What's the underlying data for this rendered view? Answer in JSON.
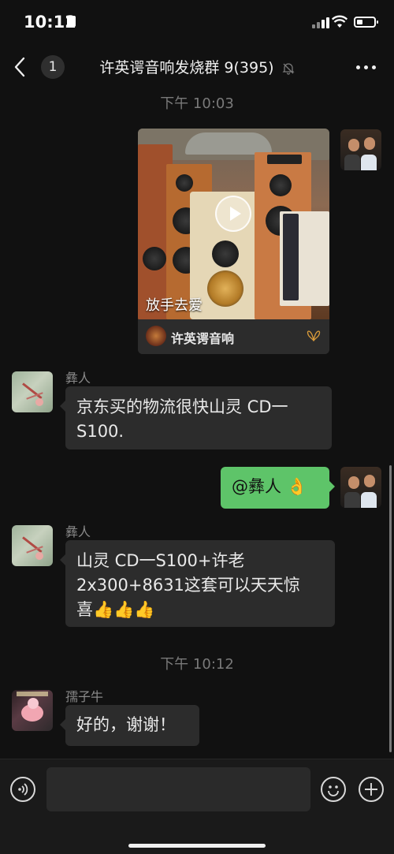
{
  "status_bar": {
    "time": "10:12"
  },
  "nav": {
    "unread_count": "1",
    "title": "许英谔音响发烧群 9(395)"
  },
  "messages": {
    "timestamp_1": "下午 10:03",
    "video_card": {
      "caption": "放手去爱",
      "channel": "许英谔音响"
    },
    "msg_1": {
      "sender": "彝人",
      "text_line1": "京东买的物流很快山灵 CD一",
      "text_line2": "S100."
    },
    "msg_2": {
      "text": "@彝人 👌"
    },
    "msg_3": {
      "sender": "彝人",
      "text_line1": "山灵 CD一S100+许老",
      "text_line2": "2x300+8631这套可以天天惊",
      "text_line3": "喜👍👍👍"
    },
    "timestamp_2": "下午 10:12",
    "msg_4": {
      "sender": "孺子牛",
      "text": "好的，谢谢！"
    }
  },
  "colors": {
    "background": "#111111",
    "bubble_in": "#2c2c2c",
    "bubble_out": "#5ec469"
  }
}
